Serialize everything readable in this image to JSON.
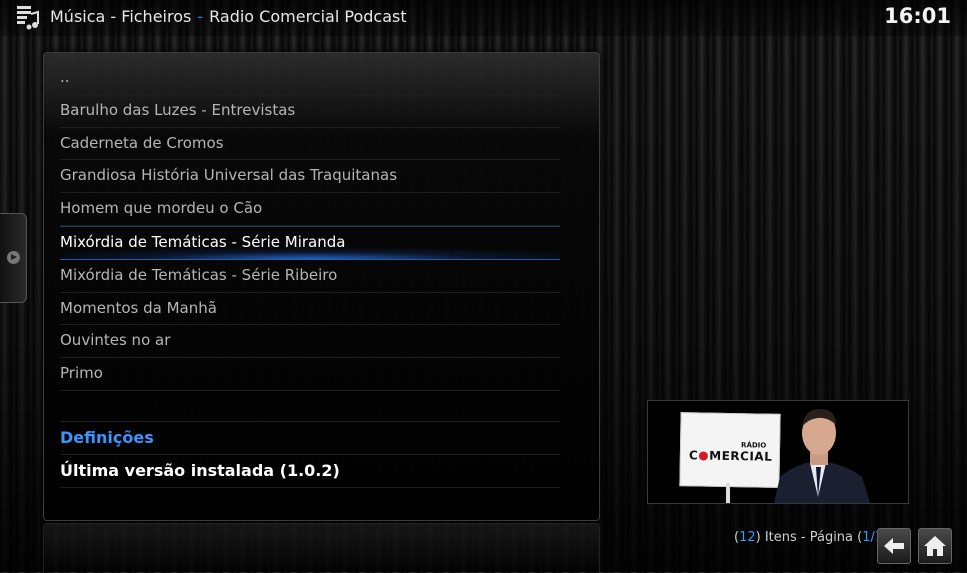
{
  "header": {
    "breadcrumb_section": "Música - Ficheiros",
    "breadcrumb_separator": "-",
    "breadcrumb_current": "Radio Comercial Podcast",
    "clock": "16:01",
    "app_icon": "music-files-icon"
  },
  "list": {
    "parent": "..",
    "items": [
      {
        "label": "Barulho das Luzes - Entrevistas"
      },
      {
        "label": "Caderneta de Cromos"
      },
      {
        "label": "Grandiosa História Universal das Traquitanas"
      },
      {
        "label": "Homem que mordeu o Cão"
      },
      {
        "label": "Mixórdia de Temáticas - Série Miranda",
        "selected": true
      },
      {
        "label": "Mixórdia de Temáticas - Série Ribeiro"
      },
      {
        "label": "Momentos da Manhã"
      },
      {
        "label": "Ouvintes no ar"
      },
      {
        "label": "Primo"
      }
    ],
    "settings_label": "Definições",
    "version_label": "Última versão instalada (1.0.2)"
  },
  "thumbnail": {
    "sign_small": "RÁDIO",
    "sign_main_prefix": "C",
    "sign_main_suffix": "MERCIAL"
  },
  "pager": {
    "open_paren": "(",
    "count": "12",
    "items_label": ") Itens - Página (",
    "page": "1/1",
    "close_paren": ")"
  },
  "colors": {
    "accent": "#3a95ff",
    "selection_glow": "#2882ff",
    "brand_red": "#d31b25"
  },
  "icons": {
    "back": "back-arrow-icon",
    "home": "home-icon",
    "side_tab": "play-circle-icon"
  }
}
